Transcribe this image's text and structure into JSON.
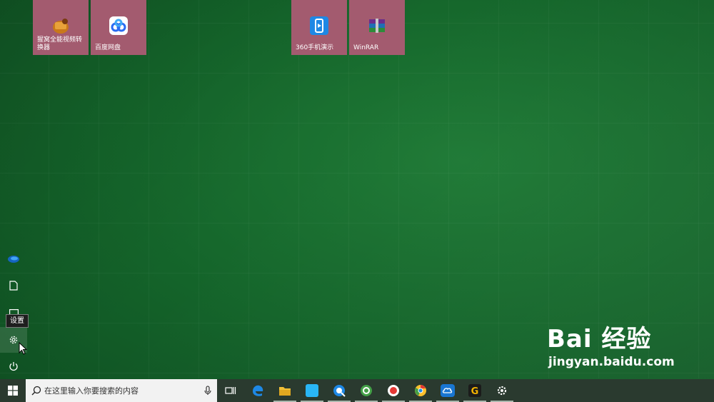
{
  "start_tiles": [
    {
      "label": "猩窝全能视频转换器",
      "icon": "video-converter-icon"
    },
    {
      "label": "百度网盘",
      "icon": "baidu-netdisk-icon"
    },
    {
      "label": "360手机演示",
      "icon": "360-phone-icon"
    },
    {
      "label": "WinRAR",
      "icon": "winrar-icon"
    }
  ],
  "left_rail": {
    "items": [
      "user-avatar-icon",
      "documents-icon",
      "pictures-icon",
      "settings-icon",
      "power-icon"
    ],
    "tooltip": "设置"
  },
  "search": {
    "placeholder": "在这里输入你要搜索的内容"
  },
  "taskbar_apps": [
    "task-view-icon",
    "edge-icon",
    "file-explorer-icon",
    "store-icon",
    "quark-browser-icon",
    "360-browser-icon",
    "screen-recorder-icon",
    "chrome-icon",
    "cloud-icon",
    "g-app-icon",
    "settings-icon"
  ],
  "watermark": {
    "brand": "Bai  经验",
    "url": "jingyan.baidu.com"
  },
  "colors": {
    "tile": "#a35b6f",
    "desktop": "#1a6d30",
    "taskbar": "#2a3a2f"
  }
}
